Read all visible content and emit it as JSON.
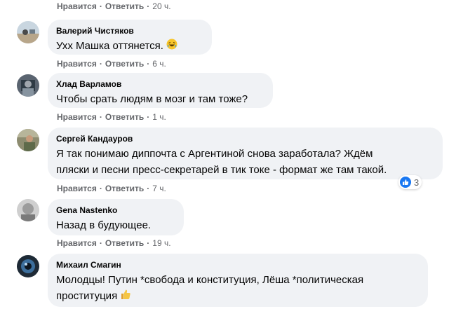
{
  "comments": [
    {
      "author": "",
      "text": "",
      "like_label": "Нравится",
      "reply_label": "Ответить",
      "time": "20 ч."
    },
    {
      "author": "Валерий Чистяков",
      "text": "Ухх Машка оттянется.",
      "like_label": "Нравится",
      "reply_label": "Ответить",
      "time": "6 ч."
    },
    {
      "author": "Хлад Варламов",
      "text": "Чтобы срать людям в мозг и там тоже?",
      "like_label": "Нравится",
      "reply_label": "Ответить",
      "time": "1 ч."
    },
    {
      "author": "Сергей Кандауров",
      "text_line1": "Я так понимаю диппочта с Аргентиной снова заработала? Ждём",
      "text_line2": "пляски и песни пресс-секретарей в тик токе - формат же там такой.",
      "like_label": "Нравится",
      "reply_label": "Ответить",
      "time": "7 ч.",
      "reaction_count": "3"
    },
    {
      "author": "Gena Nastenko",
      "text": "Назад в будующее.",
      "like_label": "Нравится",
      "reply_label": "Ответить",
      "time": "19 ч."
    },
    {
      "author": "Михаил Смагин",
      "text_line1": "Молодцы! Путин *свобода и конституция, Лёша *политическая",
      "text_line2": "проституция"
    }
  ],
  "separator": "·",
  "colors": {
    "bubble": "#f0f2f5",
    "meta": "#65676b",
    "like_blue": "#1877f2"
  },
  "icons": [
    "laughing-emoji-icon",
    "like-reaction-icon",
    "thumbs-up-emoji-icon"
  ]
}
